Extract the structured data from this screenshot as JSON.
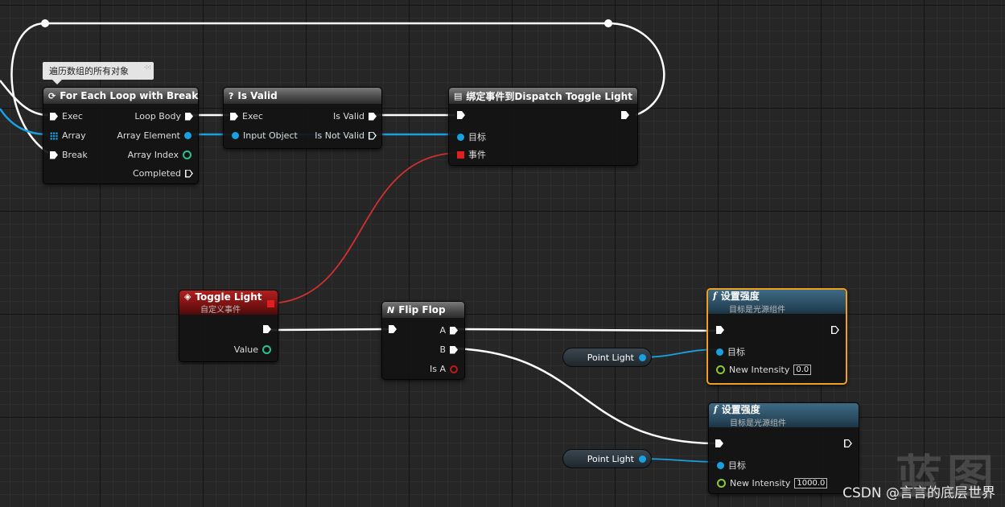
{
  "comment": {
    "text": "遍历数组的所有对象",
    "icon": "comment-bubble-icon"
  },
  "nodes": {
    "foreach": {
      "title": "For Each Loop with Break",
      "pins_in": [
        "Exec",
        "Array",
        "Break"
      ],
      "pins_out": [
        "Loop Body",
        "Array Element",
        "Array Index",
        "Completed"
      ]
    },
    "isvalid": {
      "title": "Is Valid",
      "icon_glyph": "?",
      "pins_in": [
        "Exec",
        "Input Object"
      ],
      "pins_out": [
        "Is Valid",
        "Is Not Valid"
      ]
    },
    "bind": {
      "title": "绑定事件到Dispatch Toggle Light",
      "pins_in": [
        "目标",
        "事件"
      ]
    },
    "toggle": {
      "title": "Toggle Light",
      "subtitle": "自定义事件",
      "pins_out": [
        "Value"
      ]
    },
    "flipflop": {
      "title": "Flip Flop",
      "icon_glyph": "N",
      "pins_out": [
        "A",
        "B",
        "Is A"
      ]
    },
    "set1": {
      "title": "设置强度",
      "subtitle": "目标是光源组件",
      "icon_glyph": "f",
      "pins_in": [
        "目标",
        "New Intensity"
      ],
      "intensity_value": "0.0"
    },
    "set2": {
      "title": "设置强度",
      "subtitle": "目标是光源组件",
      "icon_glyph": "f",
      "pins_in": [
        "目标",
        "New Intensity"
      ],
      "intensity_value": "1000.0"
    },
    "pointlight1": {
      "label": "Point Light"
    },
    "pointlight2": {
      "label": "Point Light"
    }
  },
  "colors": {
    "exec_wire": "#ffffff",
    "object_wire": "#19a0e0",
    "delegate_wire": "#d03030",
    "selection": "#f0a020"
  },
  "watermark": {
    "text": "蓝图"
  },
  "credit": {
    "text": "CSDN @言言的底层世界"
  }
}
